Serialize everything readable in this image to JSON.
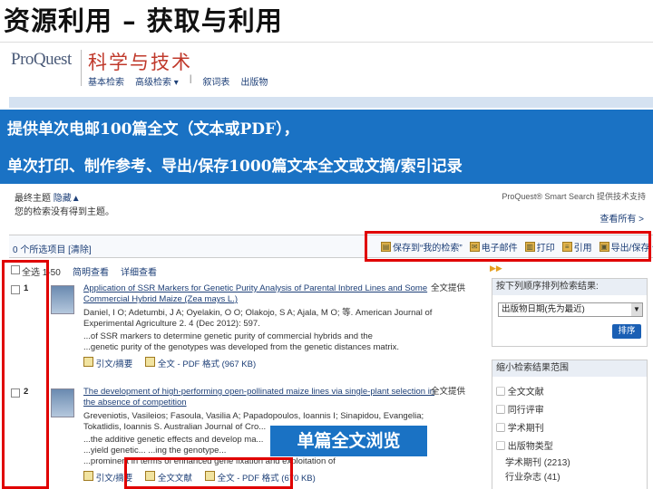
{
  "slide": {
    "title": "资源利用 – 获取与利用"
  },
  "header": {
    "logo": "ProQuest",
    "product": "科学与技术",
    "nav": [
      "基本检索",
      "高级检索 ▾",
      "|",
      "出版物"
    ],
    "nav_mid": "叙词表"
  },
  "callout": {
    "line1": "提供单次电邮100篇全文（文本或PDF），",
    "line2": "单次打印、制作参考、导出/保存1000篇文本全文或文摘/索引记录"
  },
  "saved": {
    "line1_prefix": "最终主题",
    "line1_hide": "隐藏▲",
    "line2": "您的检索没有得到主题。",
    "smart": "ProQuest® Smart Search 提供技术支持",
    "view_all": "查看所有 >"
  },
  "selectbar": {
    "selected": "0 个所选项目 [清除]",
    "toolbar": [
      {
        "icon": "folder-icon",
        "label": "保存到“我的检索”"
      },
      {
        "icon": "email-icon",
        "label": "电子邮件"
      },
      {
        "icon": "print-icon",
        "label": "打印"
      },
      {
        "icon": "cite-icon",
        "label": "引用"
      },
      {
        "icon": "save-icon",
        "label": "导出/保存 ▾"
      }
    ]
  },
  "results": {
    "head": {
      "range": "全选 1-50",
      "brief": "简明查看",
      "detail": "详细查看"
    },
    "items": [
      {
        "num": "1",
        "title": "Application of SSR Markers for Genetic Purity Analysis of Parental Inbred Lines and Some Commercial Hybrid Maize (Zea mays L.)",
        "fulltext": "全文提供",
        "authors": "Daniel, I O; Adetumbi, J A; Oyelakin, O O; Olakojo, S A; Ajala, M O; 等. American Journal of Experimental Agriculture 2. 4 (Dec 2012): 597.",
        "snip1": "...of SSR markers to determine genetic purity of commercial hybrids and the",
        "snip2": "...genetic purity of the genotypes was developed from the genetic distances matrix.",
        "links": [
          "引文/摘要",
          "全文 - PDF 格式 (967 KB)"
        ]
      },
      {
        "num": "2",
        "title": "The development of high-performing open-pollinated maize lines via single-plant selection in the absence of competition",
        "fulltext": "全文提供",
        "authors": "Greveniotis, Vasileios; Fasoula, Vasilia A; Papadopoulos, Ioannis I; Sinapidou, Evangelia; Tokatlidis, Ioannis S. Australian Journal of Cro...",
        "snip1": "...the additive genetic effects and develop ma...",
        "snip2": "...yield genetic... ...ing the genotype...",
        "snip3": "...prominent in terms of enhanced gene fixation and exploitation of",
        "links": [
          "引文/摘要",
          "全文文献",
          "全文 - PDF 格式 (670 KB)"
        ]
      }
    ]
  },
  "sidebar": {
    "arrows": "▶▶",
    "sort_head": "按下列顺序排列检索结果:",
    "sort_value": "出版物日期(先为最近)",
    "sort_btn": "排序",
    "narrow_head": "缩小检索结果范围",
    "facets": [
      "▢ 全文文献",
      "▢ 同行评审",
      "▢ 学术期刊",
      "▢ 出版物类型"
    ],
    "sub_facets": [
      "学术期刊 (2213)",
      "行业杂志 (41)"
    ]
  },
  "overlay": {
    "label": "单篇全文浏览"
  }
}
